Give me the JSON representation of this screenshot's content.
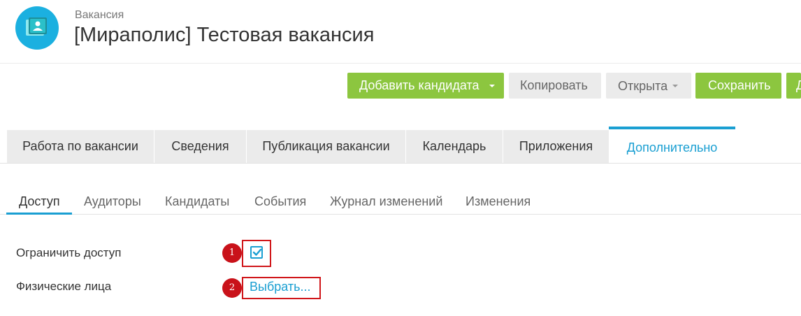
{
  "header": {
    "subtitle": "Вакансия",
    "title": "[Мираполис] Тестовая вакансия",
    "logo_icon": "contact-card-icon",
    "logo_color": "#1bb0e0"
  },
  "toolbar": {
    "add_candidate": "Добавить кандидата",
    "copy": "Копировать",
    "status": "Открыта",
    "save": "Сохранить",
    "cut_off": "Д"
  },
  "tabs": [
    {
      "label": "Работа по вакансии"
    },
    {
      "label": "Сведения"
    },
    {
      "label": "Публикация вакансии"
    },
    {
      "label": "Календарь"
    },
    {
      "label": "Приложения"
    },
    {
      "label": "Дополнительно",
      "active": true
    }
  ],
  "subtabs": [
    {
      "label": "Доступ",
      "active": true
    },
    {
      "label": "Аудиторы"
    },
    {
      "label": "Кандидаты"
    },
    {
      "label": "События"
    },
    {
      "label": "Журнал изменений"
    },
    {
      "label": "Изменения"
    }
  ],
  "form": {
    "restrict_label": "Ограничить доступ",
    "restrict_checked": true,
    "persons_label": "Физические лица",
    "persons_link": "Выбрать..."
  },
  "annotations": {
    "marker1": "1",
    "marker2": "2",
    "color": "#d0161a"
  },
  "colors": {
    "accent": "#1a9fd2",
    "green": "#8cc63f"
  }
}
